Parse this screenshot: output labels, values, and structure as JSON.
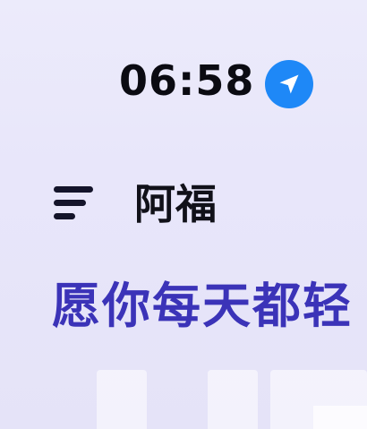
{
  "status_bar": {
    "time": "06:58",
    "location_icon": "location-arrow-icon",
    "location_color": "#1e88f7"
  },
  "header": {
    "menu_icon": "hamburger-menu-icon",
    "title": "阿福"
  },
  "main": {
    "greeting": "愿你每天都轻",
    "greeting_color": "#3b33b8"
  }
}
